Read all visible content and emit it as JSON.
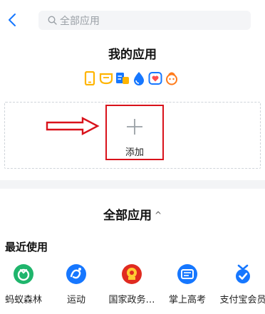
{
  "search": {
    "placeholder": "全部应用"
  },
  "my_apps": {
    "title": "我的应用",
    "mini_icons": [
      "phone-icon",
      "cup-icon",
      "document-icon",
      "water-drop-icon",
      "heart-shield-icon",
      "mascot-icon"
    ],
    "add_label": "添加"
  },
  "all_apps": {
    "title": "全部应用",
    "chevron": "^"
  },
  "recent": {
    "label": "最近使用",
    "apps": [
      {
        "label": "蚂蚁森林",
        "icon": "ant-forest-icon"
      },
      {
        "label": "运动",
        "icon": "sports-icon"
      },
      {
        "label": "国家政务…",
        "icon": "government-icon"
      },
      {
        "label": "掌上高考",
        "icon": "gaokao-icon"
      },
      {
        "label": "支付宝会员",
        "icon": "alipay-member-icon"
      }
    ]
  },
  "colors": {
    "accent": "#1677ff",
    "highlight": "#d9121b",
    "forest": "#1fb56c",
    "gov": "#e02b20",
    "mini_orange": "#ffb400"
  }
}
